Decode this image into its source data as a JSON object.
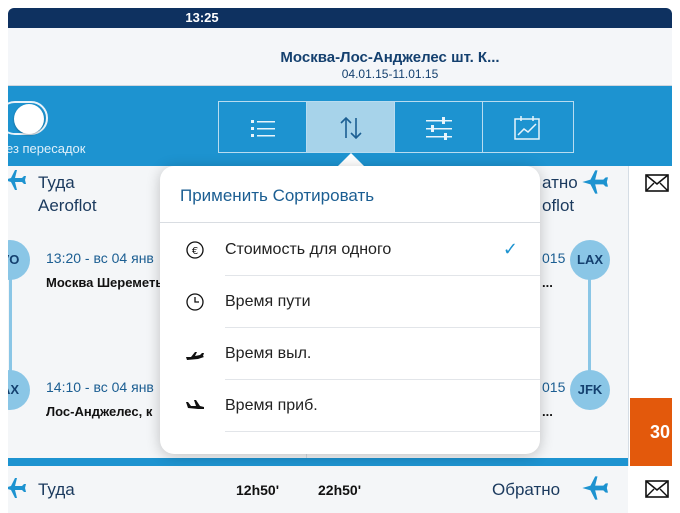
{
  "status": {
    "time": "13:25"
  },
  "header": {
    "title": "Москва-Лос-Анджелес шт. К...",
    "dates": "04.01.15-11.01.15"
  },
  "toolbar": {
    "toggle_label": "ез пересадок",
    "segments": [
      {
        "name": "list",
        "icon": "list-icon"
      },
      {
        "name": "sort",
        "icon": "sort-arrows-icon",
        "active": true
      },
      {
        "name": "filter",
        "icon": "sliders-icon"
      },
      {
        "name": "chart",
        "icon": "calendar-chart-icon"
      }
    ]
  },
  "outbound": {
    "direction": "Туда",
    "airline": "Aeroflot",
    "dep_node": "VO",
    "dep_time": "13:20 - вс 04 янв",
    "dep_station": "Москва Шереметь",
    "arr_node": "AX",
    "arr_time": "14:10 - вс 04 янв",
    "arr_station": "Лос-Анджелес, к"
  },
  "return": {
    "direction": "атно",
    "airline": "oflot",
    "dep_year": "015",
    "dep_station_tail": "...",
    "dep_node": "LAX",
    "arr_year": "015",
    "arr_station_tail": "...",
    "arr_node": "JFK"
  },
  "price_badge": "30",
  "bottom": {
    "direction_out": "Туда",
    "duration_out": "12h50'",
    "duration_back": "22h50'",
    "direction_back": "Обратно"
  },
  "sort_popover": {
    "apply_label": "Применить",
    "title": "Сортировать",
    "options": [
      {
        "label": "Стоимость для одного",
        "icon": "euro-circle-icon",
        "checked": true
      },
      {
        "label": "Время пути",
        "icon": "clock-icon",
        "checked": false
      },
      {
        "label": "Время выл.",
        "icon": "plane-takeoff-icon",
        "checked": false
      },
      {
        "label": "Время приб.",
        "icon": "plane-landing-icon",
        "checked": false
      }
    ],
    "check_glyph": "✓"
  },
  "colors": {
    "brand_blue": "#1d93d0",
    "navy": "#0e3160",
    "accent_orange": "#e3590c",
    "node_blue": "#8ac6e6"
  }
}
